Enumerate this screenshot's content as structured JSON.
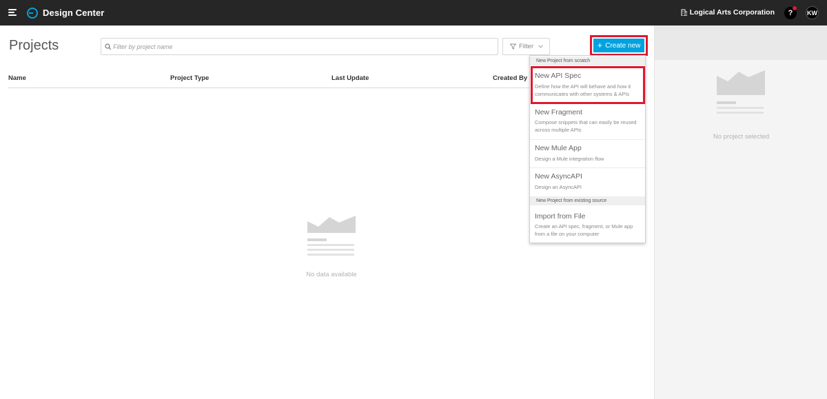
{
  "header": {
    "app_title": "Design Center",
    "org_name": "Logical Arts Corporation",
    "help_label": "?",
    "avatar_initials": "KW"
  },
  "main": {
    "page_title": "Projects",
    "search_placeholder": "Filter by project name",
    "filter_label": "Filter",
    "create_label": "Create new",
    "columns": [
      "Name",
      "Project Type",
      "Last Update",
      "Created By"
    ],
    "empty_text": "No data available"
  },
  "side_panel": {
    "empty_text": "No project selected"
  },
  "create_menu": {
    "section_scratch": "New Project from scratch",
    "items": [
      {
        "title": "New API Spec",
        "desc": "Define how the API will behave and how it communicates with other systems & APIs"
      },
      {
        "title": "New Fragment",
        "desc": "Compose snippets that can easily be reused across multiple APIs"
      },
      {
        "title": "New Mule App",
        "desc": "Design a Mule integration flow"
      },
      {
        "title": "New AsyncAPI",
        "desc": "Design an AsyncAPI"
      }
    ],
    "section_existing": "New Project from existing source",
    "import_item": {
      "title": "Import from File",
      "desc": "Create an API spec, fragment, or Mule app from a file on your computer"
    }
  },
  "colors": {
    "topbar": "#262626",
    "accent": "#00a2df",
    "highlight": "#e0172f"
  }
}
